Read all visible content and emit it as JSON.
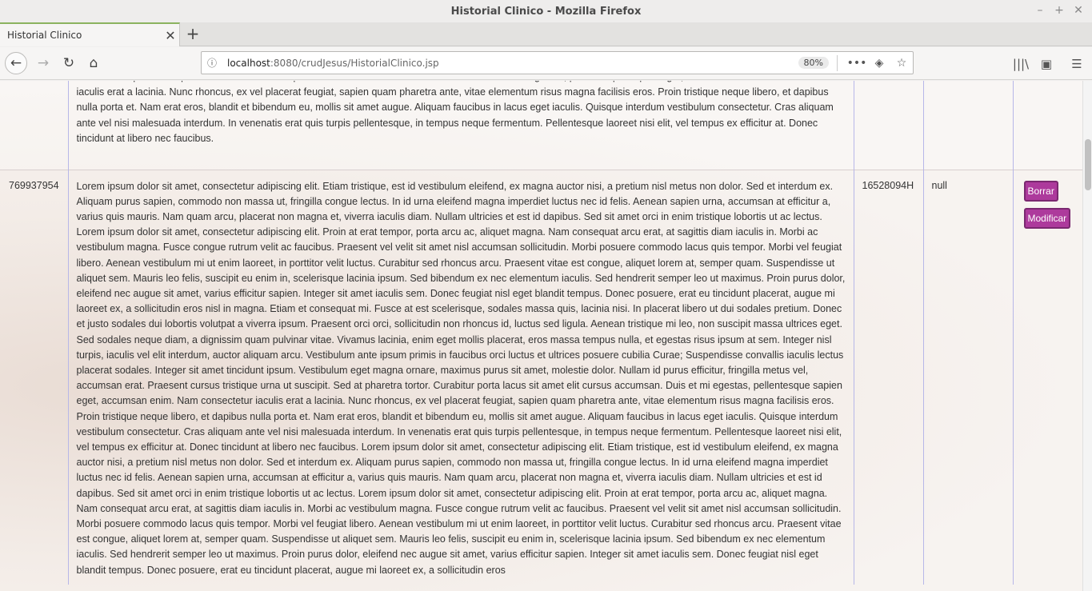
{
  "window": {
    "title": "Historial Clinico - Mozilla Firefox",
    "minimize": "–",
    "maximize": "+",
    "close": "✕"
  },
  "tabs": [
    {
      "title": "Historial Clinico",
      "close": "✕"
    }
  ],
  "newtab": "+",
  "nav": {
    "back": "←",
    "forward": "→",
    "reload": "↻",
    "home": "⌂",
    "info": "ⓘ",
    "url_host": "localhost",
    "url_rest": ":8080/crudJesus/HistorialClinico.jsp",
    "zoom": "80%",
    "more": "•••",
    "pocket": "◈",
    "bookmark": "☆",
    "library": "|||\\",
    "sidebar": "▣",
    "menu": "☰"
  },
  "rows": [
    {
      "id": "",
      "text": "urna ut suscipit. Sed at pharetra tortor. Curabitur porta lacus sit amet elit cursus accumsan. Duis et mi egestas, pellentesque sapien eget, accumsan enim. Nam consectetur iaculis erat a lacinia. Nunc rhoncus, ex vel placerat feugiat, sapien quam pharetra ante, vitae elementum risus magna facilisis eros. Proin tristique neque libero, et dapibus nulla porta et. Nam erat eros, blandit et bibendum eu, mollis sit amet augue. Aliquam faucibus in lacus eget iaculis. Quisque interdum vestibulum consectetur. Cras aliquam ante vel nisi malesuada interdum. In venenatis erat quis turpis pellentesque, in tempus neque fermentum. Pellentesque laoreet nisi elit, vel tempus ex efficitur at. Donec tincidunt at libero nec faucibus.",
      "dni": "",
      "extra": ""
    },
    {
      "id": "769937954",
      "text": "Lorem ipsum dolor sit amet, consectetur adipiscing elit. Etiam tristique, est id vestibulum eleifend, ex magna auctor nisi, a pretium nisl metus non dolor. Sed et interdum ex. Aliquam purus sapien, commodo non massa ut, fringilla congue lectus. In id urna eleifend magna imperdiet luctus nec id felis. Aenean sapien urna, accumsan at efficitur a, varius quis mauris. Nam quam arcu, placerat non magna et, viverra iaculis diam. Nullam ultricies et est id dapibus. Sed sit amet orci in enim tristique lobortis ut ac lectus. Lorem ipsum dolor sit amet, consectetur adipiscing elit. Proin at erat tempor, porta arcu ac, aliquet magna. Nam consequat arcu erat, at sagittis diam iaculis in. Morbi ac vestibulum magna. Fusce congue rutrum velit ac faucibus. Praesent vel velit sit amet nisl accumsan sollicitudin. Morbi posuere commodo lacus quis tempor. Morbi vel feugiat libero. Aenean vestibulum mi ut enim laoreet, in porttitor velit luctus. Curabitur sed rhoncus arcu. Praesent vitae est congue, aliquet lorem at, semper quam. Suspendisse ut aliquet sem. Mauris leo felis, suscipit eu enim in, scelerisque lacinia ipsum. Sed bibendum ex nec elementum iaculis. Sed hendrerit semper leo ut maximus. Proin purus dolor, eleifend nec augue sit amet, varius efficitur sapien. Integer sit amet iaculis sem. Donec feugiat nisl eget blandit tempus. Donec posuere, erat eu tincidunt placerat, augue mi laoreet ex, a sollicitudin eros nisl in magna. Etiam et consequat mi. Fusce at est scelerisque, sodales massa quis, lacinia nisi. In placerat libero ut dui sodales pretium. Donec et justo sodales dui lobortis volutpat a viverra ipsum. Praesent orci orci, sollicitudin non rhoncus id, luctus sed ligula. Aenean tristique mi leo, non suscipit massa ultrices eget. Sed sodales neque diam, a dignissim quam pulvinar vitae. Vivamus lacinia, enim eget mollis placerat, eros massa tempus nulla, et egestas risus ipsum at sem. Integer nisl turpis, iaculis vel elit interdum, auctor aliquam arcu. Vestibulum ante ipsum primis in faucibus orci luctus et ultrices posuere cubilia Curae; Suspendisse convallis iaculis lectus placerat sodales. Integer sit amet tincidunt ipsum. Vestibulum eget magna ornare, maximus purus sit amet, molestie dolor. Nullam id purus efficitur, fringilla metus vel, accumsan erat. Praesent cursus tristique urna ut suscipit. Sed at pharetra tortor. Curabitur porta lacus sit amet elit cursus accumsan. Duis et mi egestas, pellentesque sapien eget, accumsan enim. Nam consectetur iaculis erat a lacinia. Nunc rhoncus, ex vel placerat feugiat, sapien quam pharetra ante, vitae elementum risus magna facilisis eros. Proin tristique neque libero, et dapibus nulla porta et. Nam erat eros, blandit et bibendum eu, mollis sit amet augue. Aliquam faucibus in lacus eget iaculis. Quisque interdum vestibulum consectetur. Cras aliquam ante vel nisi malesuada interdum. In venenatis erat quis turpis pellentesque, in tempus neque fermentum. Pellentesque laoreet nisi elit, vel tempus ex efficitur at. Donec tincidunt at libero nec faucibus. Lorem ipsum dolor sit amet, consectetur adipiscing elit. Etiam tristique, est id vestibulum eleifend, ex magna auctor nisi, a pretium nisl metus non dolor. Sed et interdum ex. Aliquam purus sapien, commodo non massa ut, fringilla congue lectus. In id urna eleifend magna imperdiet luctus nec id felis. Aenean sapien urna, accumsan at efficitur a, varius quis mauris. Nam quam arcu, placerat non magna et, viverra iaculis diam. Nullam ultricies et est id dapibus. Sed sit amet orci in enim tristique lobortis ut ac lectus. Lorem ipsum dolor sit amet, consectetur adipiscing elit. Proin at erat tempor, porta arcu ac, aliquet magna. Nam consequat arcu erat, at sagittis diam iaculis in. Morbi ac vestibulum magna. Fusce congue rutrum velit ac faucibus. Praesent vel velit sit amet nisl accumsan sollicitudin. Morbi posuere commodo lacus quis tempor. Morbi vel feugiat libero. Aenean vestibulum mi ut enim laoreet, in porttitor velit luctus. Curabitur sed rhoncus arcu. Praesent vitae est congue, aliquet lorem at, semper quam. Suspendisse ut aliquet sem. Mauris leo felis, suscipit eu enim in, scelerisque lacinia ipsum. Sed bibendum ex nec elementum iaculis. Sed hendrerit semper leo ut maximus. Proin purus dolor, eleifend nec augue sit amet, varius efficitur sapien. Integer sit amet iaculis sem. Donec feugiat nisl eget blandit tempus. Donec posuere, erat eu tincidunt placerat, augue mi laoreet ex, a sollicitudin eros",
      "dni": "16528094H",
      "extra": "null",
      "btn_delete": "Borrar",
      "btn_edit": "Modificar"
    }
  ]
}
